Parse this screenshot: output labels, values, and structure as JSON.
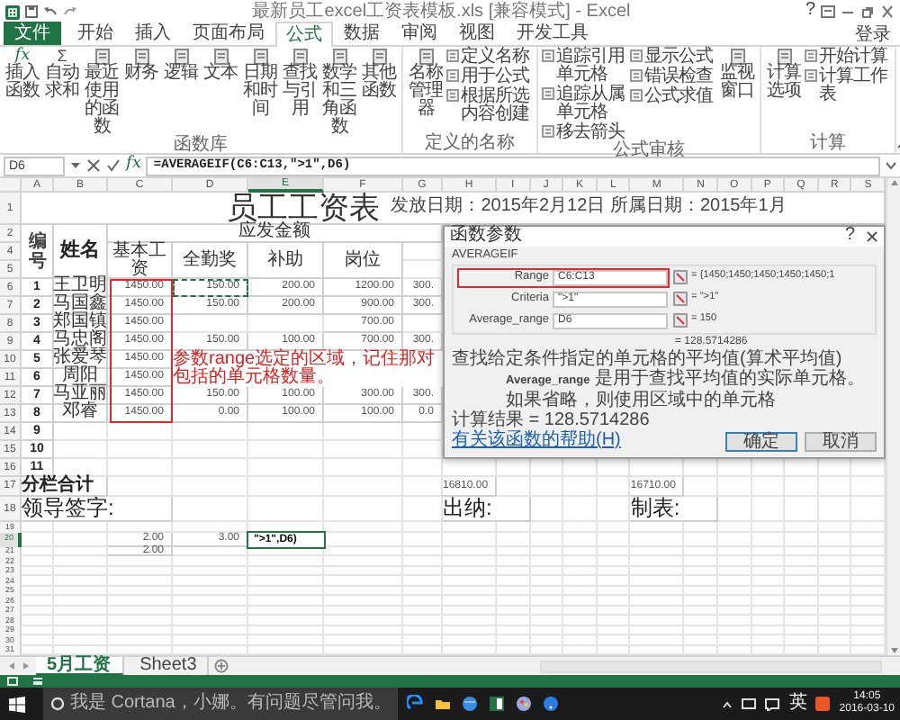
{
  "window": {
    "title": "最新员工excel工资表模板.xls [兼容模式] - Excel",
    "help": "?"
  },
  "ribbon_tabs": [
    {
      "label": "文件",
      "kind": "file",
      "selected": false
    },
    {
      "label": "开始",
      "kind": "tab",
      "selected": false
    },
    {
      "label": "插入",
      "kind": "tab",
      "selected": false
    },
    {
      "label": "页面布局",
      "kind": "tab",
      "selected": false
    },
    {
      "label": "公式",
      "kind": "tab",
      "selected": true
    },
    {
      "label": "数据",
      "kind": "tab",
      "selected": false
    },
    {
      "label": "审阅",
      "kind": "tab",
      "selected": false
    },
    {
      "label": "视图",
      "kind": "tab",
      "selected": false
    },
    {
      "label": "开发工具",
      "kind": "tab",
      "selected": false
    }
  ],
  "account": "登录",
  "ribbon_groups": [
    {
      "label": "函数库",
      "items": [
        {
          "kind": "large",
          "label": "插入函数",
          "glyph": "fx"
        },
        {
          "kind": "large",
          "label": "自动求和",
          "glyph": "Σ"
        },
        {
          "kind": "large",
          "label": "最近使用的函数"
        },
        {
          "kind": "large",
          "label": "财务"
        },
        {
          "kind": "large",
          "label": "逻辑"
        },
        {
          "kind": "large",
          "label": "文本"
        },
        {
          "kind": "large",
          "label": "日期和时间"
        },
        {
          "kind": "large",
          "label": "查找与引用"
        },
        {
          "kind": "large",
          "label": "数学和三角函数"
        },
        {
          "kind": "large",
          "label": "其他函数"
        }
      ]
    },
    {
      "label": "定义的名称",
      "items": [
        {
          "kind": "large",
          "label": "名称管理器"
        },
        {
          "kind": "stack",
          "items": [
            {
              "label": "定义名称"
            },
            {
              "label": "用于公式"
            },
            {
              "label": "根据所选内容创建"
            }
          ]
        }
      ]
    },
    {
      "label": "公式审核",
      "items": [
        {
          "kind": "stack",
          "items": [
            {
              "label": "追踪引用单元格"
            },
            {
              "label": "追踪从属单元格"
            },
            {
              "label": "移去箭头"
            }
          ]
        },
        {
          "kind": "stack",
          "items": [
            {
              "label": "显示公式"
            },
            {
              "label": "错误检查"
            },
            {
              "label": "公式求值"
            }
          ]
        },
        {
          "kind": "large",
          "label": "监视窗口"
        }
      ]
    },
    {
      "label": "计算",
      "items": [
        {
          "kind": "large",
          "label": "计算选项"
        },
        {
          "kind": "stack",
          "items": [
            {
              "label": "开始计算"
            },
            {
              "label": "计算工作表"
            }
          ]
        }
      ]
    }
  ],
  "formula_bar": {
    "name_box": "D6",
    "function_button": "fx",
    "formula": "=AVERAGEIF(C6:C13,\">1\",D6)"
  },
  "sheet": {
    "columns": [
      {
        "letter": "A",
        "selected": false
      },
      {
        "letter": "B",
        "selected": false
      },
      {
        "letter": "C",
        "selected": false
      },
      {
        "letter": "D",
        "selected": false
      },
      {
        "letter": "E",
        "selected": true
      },
      {
        "letter": "F",
        "selected": false
      },
      {
        "letter": "G",
        "selected": false
      },
      {
        "letter": "H",
        "selected": false
      },
      {
        "letter": "I",
        "selected": false
      },
      {
        "letter": "J",
        "selected": false
      },
      {
        "letter": "K",
        "selected": false
      },
      {
        "letter": "L",
        "selected": false
      },
      {
        "letter": "M",
        "selected": false
      },
      {
        "letter": "N",
        "selected": false
      },
      {
        "letter": "O",
        "selected": false
      },
      {
        "letter": "P",
        "selected": false
      },
      {
        "letter": "Q",
        "selected": false
      },
      {
        "letter": "R",
        "selected": false
      },
      {
        "letter": "S",
        "selected": false
      }
    ],
    "title_row": {
      "number": "1",
      "title": "员工工资表",
      "subtitle": "发放日期：2015年2月12日 所属日期：2015年1月"
    },
    "header": {
      "numbers": [
        "2",
        "4",
        "5"
      ],
      "id_label": "编号",
      "name_label": "姓名",
      "group_label": "应发金额",
      "columns": [
        "基本工资",
        "全勤奖",
        "补助",
        "岗位"
      ]
    },
    "data_rows": [
      {
        "number": "6",
        "id": "1",
        "name": "王卫明",
        "column_c": "1450.00",
        "column_d": {
          "text": "150.00",
          "marquee": true
        },
        "column_e": "200.00",
        "column_f": "1200.00",
        "column_g": "300."
      },
      {
        "number": "7",
        "id": "2",
        "name": "马国鑫",
        "column_c": "1450.00",
        "column_d": "150.00",
        "column_e": "200.00",
        "column_f": "900.00",
        "column_g": "300."
      },
      {
        "number": "8",
        "id": "3",
        "name": "郑国镇",
        "column_c": "1450.00",
        "column_f": "700.00"
      },
      {
        "number": "9",
        "id": "4",
        "name": "马忠阁",
        "column_c": "1450.00",
        "column_d": "150.00",
        "column_e": "100.00",
        "column_f": "700.00",
        "column_g": "300."
      },
      {
        "number": "10",
        "id": "5",
        "name": "张爱琴",
        "column_c": "1450.00"
      },
      {
        "number": "11",
        "id": "6",
        "name": "周阳",
        "column_c": "1450.00"
      },
      {
        "number": "12",
        "id": "7",
        "name": "马亚丽",
        "column_c": "1450.00",
        "column_d": "150.00",
        "column_e": "100.00",
        "column_f": "300.00",
        "column_g": "300."
      },
      {
        "number": "13",
        "id": "8",
        "name": "邓睿",
        "column_c": "1450.00",
        "column_d": "0.00",
        "column_e": "100.00",
        "column_f": "100.00",
        "column_g": "0.0"
      }
    ],
    "blank_rows": [
      {
        "number": "14",
        "id": "9"
      },
      {
        "number": "15",
        "id": "10"
      },
      {
        "number": "16",
        "id": "11"
      }
    ],
    "total_row": {
      "number": "17",
      "label": "分栏合计",
      "column_h": "16810.00",
      "column_m": "16710.00"
    },
    "signature_row": {
      "number": "18",
      "column_a": "领导签字:",
      "column_h": "出纳:",
      "column_m": "制表:"
    },
    "extra_rows": [
      {
        "number": "19",
        "selected": false
      },
      {
        "number": "20",
        "selected": true,
        "column_c": "2.00",
        "column_d": "3.00",
        "column_e": {
          "text": "\">1\",D6)",
          "active": true
        }
      },
      {
        "number": "21",
        "selected": false,
        "column_c": "2.00"
      },
      {
        "number": "22",
        "selected": false
      },
      {
        "number": "23",
        "selected": false
      },
      {
        "number": "24",
        "selected": false
      },
      {
        "number": "25",
        "selected": false
      },
      {
        "number": "26",
        "selected": false
      },
      {
        "number": "27",
        "selected": false
      },
      {
        "number": "28",
        "selected": false
      },
      {
        "number": "29",
        "selected": false
      },
      {
        "number": "30",
        "selected": false
      },
      {
        "number": "31",
        "selected": false
      }
    ],
    "annotation": {
      "text": "参数range选定的区域，记住那对包括的单元格数量。",
      "outlined": true
    }
  },
  "dialog": {
    "title": "函数参数",
    "help": "?",
    "function": "AVERAGEIF",
    "arguments": [
      {
        "label": "Range",
        "value": "C6:C13",
        "result": "= {1450;1450;1450;1450;1450;1",
        "highlighted": true
      },
      {
        "label": "Criteria",
        "value": "\">1\"",
        "result": "= \">1\"",
        "highlighted": false
      },
      {
        "label": "Average_range",
        "value": "D6",
        "result": "= 150",
        "highlighted": false
      }
    ],
    "formula_result": "= 128.5714286",
    "description": "查找给定条件指定的单元格的平均值(算术平均值)",
    "argument_name": "Average_range",
    "argument_help": "是用于查找平均值的实际单元格。如果省略，则使用区域中的单元格",
    "calculation": "计算结果 = 128.5714286",
    "help_link": "有关该函数的帮助(H)",
    "buttons": [
      {
        "label": "确定",
        "kind": "ok"
      },
      {
        "label": "取消",
        "kind": "cancel"
      }
    ]
  },
  "sheet_tabs": [
    {
      "label": "5月工资",
      "selected": true
    },
    {
      "label": "Sheet3",
      "selected": false
    }
  ],
  "taskbar": {
    "search_placeholder": "我是 Cortana，小娜。有问题尽管问我。",
    "ime": "英",
    "time": "14:05",
    "date": "2016-03-10"
  }
}
